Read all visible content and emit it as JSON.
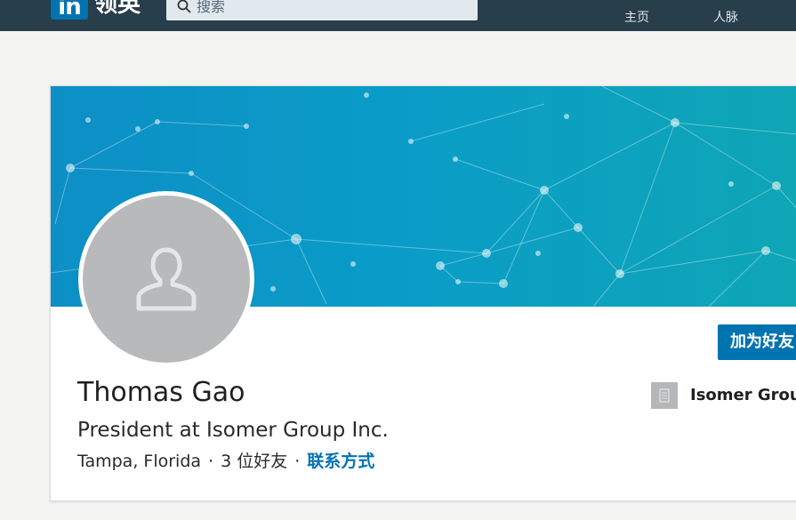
{
  "header": {
    "logo_mark": "in",
    "logo_text": "领英",
    "search_placeholder": "搜索",
    "nav": [
      {
        "label": "主页",
        "icon": "home-icon"
      },
      {
        "label": "人脉",
        "icon": "people-icon"
      }
    ]
  },
  "profile": {
    "name": "Thomas Gao",
    "headline": "President at Isomer Group Inc.",
    "location": "Tampa, Florida",
    "separator": "·",
    "connections": "3 位好友",
    "contact_info": "联系方式",
    "connect_button": "加为好友",
    "company": "Isomer Group"
  },
  "colors": {
    "topbar": "#283e4a",
    "brand": "#0073b1",
    "cover_start": "#0d8fc5",
    "cover_end": "#0fa6b5"
  }
}
